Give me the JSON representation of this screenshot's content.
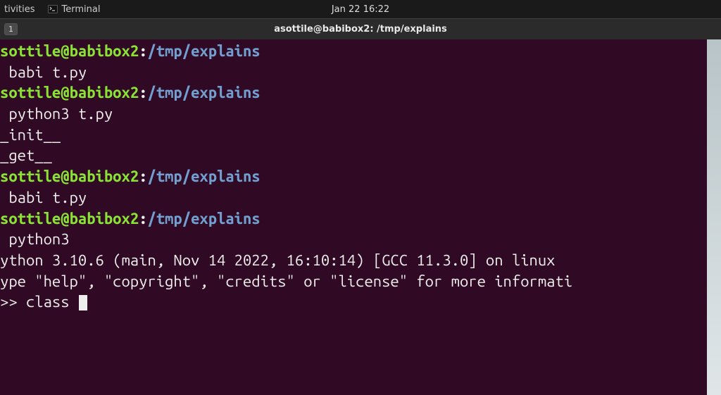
{
  "topbar": {
    "activities": "tivities",
    "terminal_label": "Terminal",
    "clock": "Jan 22  16:22"
  },
  "titlebar": {
    "tab_badge": "1",
    "title": "asottile@babibox2: /tmp/explains"
  },
  "prompt": {
    "user": "sottile",
    "at": "@",
    "host": "babibox2",
    "colon": ":",
    "path": "/tmp/explains"
  },
  "session": {
    "lines": [
      {
        "type": "prompt"
      },
      {
        "type": "cmd",
        "text": " babi t.py"
      },
      {
        "type": "prompt"
      },
      {
        "type": "cmd",
        "text": " python3 t.py"
      },
      {
        "type": "out",
        "text": "_init__"
      },
      {
        "type": "out",
        "text": "_get__"
      },
      {
        "type": "out",
        "text": ""
      },
      {
        "type": "prompt"
      },
      {
        "type": "cmd",
        "text": " babi t.py"
      },
      {
        "type": "prompt"
      },
      {
        "type": "cmd",
        "text": " python3"
      },
      {
        "type": "out",
        "text": "ython 3.10.6 (main, Nov 14 2022, 16:10:14) [GCC 11.3.0] on linux"
      },
      {
        "type": "out",
        "text": "ype \"help\", \"copyright\", \"credits\" or \"license\" for more informati"
      },
      {
        "type": "repl",
        "prefix": ">> ",
        "text": "class ",
        "cursor": true
      }
    ]
  }
}
